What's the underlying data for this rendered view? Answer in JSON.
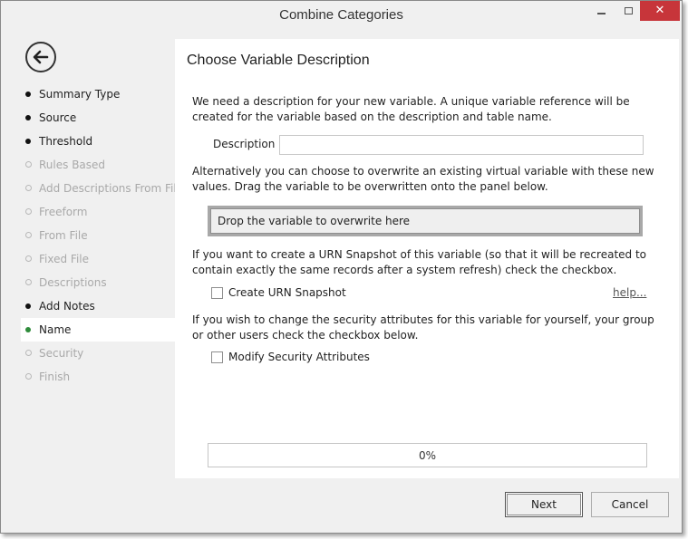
{
  "window": {
    "title": "Combine Categories",
    "minimize_glyph": "",
    "close_glyph": "✕"
  },
  "sidebar": {
    "back_icon": "back-arrow-icon",
    "steps": [
      {
        "label": "Summary Type",
        "state": "done"
      },
      {
        "label": "Source",
        "state": "done"
      },
      {
        "label": "Threshold",
        "state": "done"
      },
      {
        "label": "Rules Based",
        "state": "disabled"
      },
      {
        "label": "Add Descriptions From File",
        "state": "disabled"
      },
      {
        "label": "Freeform",
        "state": "disabled"
      },
      {
        "label": "From File",
        "state": "disabled"
      },
      {
        "label": "Fixed File",
        "state": "disabled"
      },
      {
        "label": "Descriptions",
        "state": "disabled"
      },
      {
        "label": "Add Notes",
        "state": "done"
      },
      {
        "label": "Name",
        "state": "current"
      },
      {
        "label": "Security",
        "state": "disabled"
      },
      {
        "label": "Finish",
        "state": "disabled"
      }
    ]
  },
  "panel": {
    "title": "Choose Variable Description",
    "intro": "We need a description for your new variable.  A unique variable reference will be created for the variable based on the description and table name.",
    "description_label": "Description",
    "description_value": "",
    "overwrite_text": "Alternatively you can choose to overwrite an existing virtual variable with these new values. Drag the variable to be overwritten onto the panel below.",
    "dropzone_text": "Drop the variable to overwrite here",
    "urn_text": "If you want to create a URN Snapshot of this variable (so that it will be recreated to contain exactly the same records after a system refresh) check the checkbox.",
    "urn_checkbox_label": "Create URN Snapshot",
    "help_link": "help...",
    "security_text": "If you wish to change the security attributes for this variable for yourself, your group or other users check the checkbox below.",
    "security_checkbox_label": "Modify Security Attributes",
    "progress_value": 0,
    "progress_text": "0%"
  },
  "buttons": {
    "next": "Next",
    "cancel": "Cancel"
  },
  "colors": {
    "accent": "#2e8b3a",
    "close": "#c7353a",
    "disabled_text": "#a9a9a9"
  }
}
